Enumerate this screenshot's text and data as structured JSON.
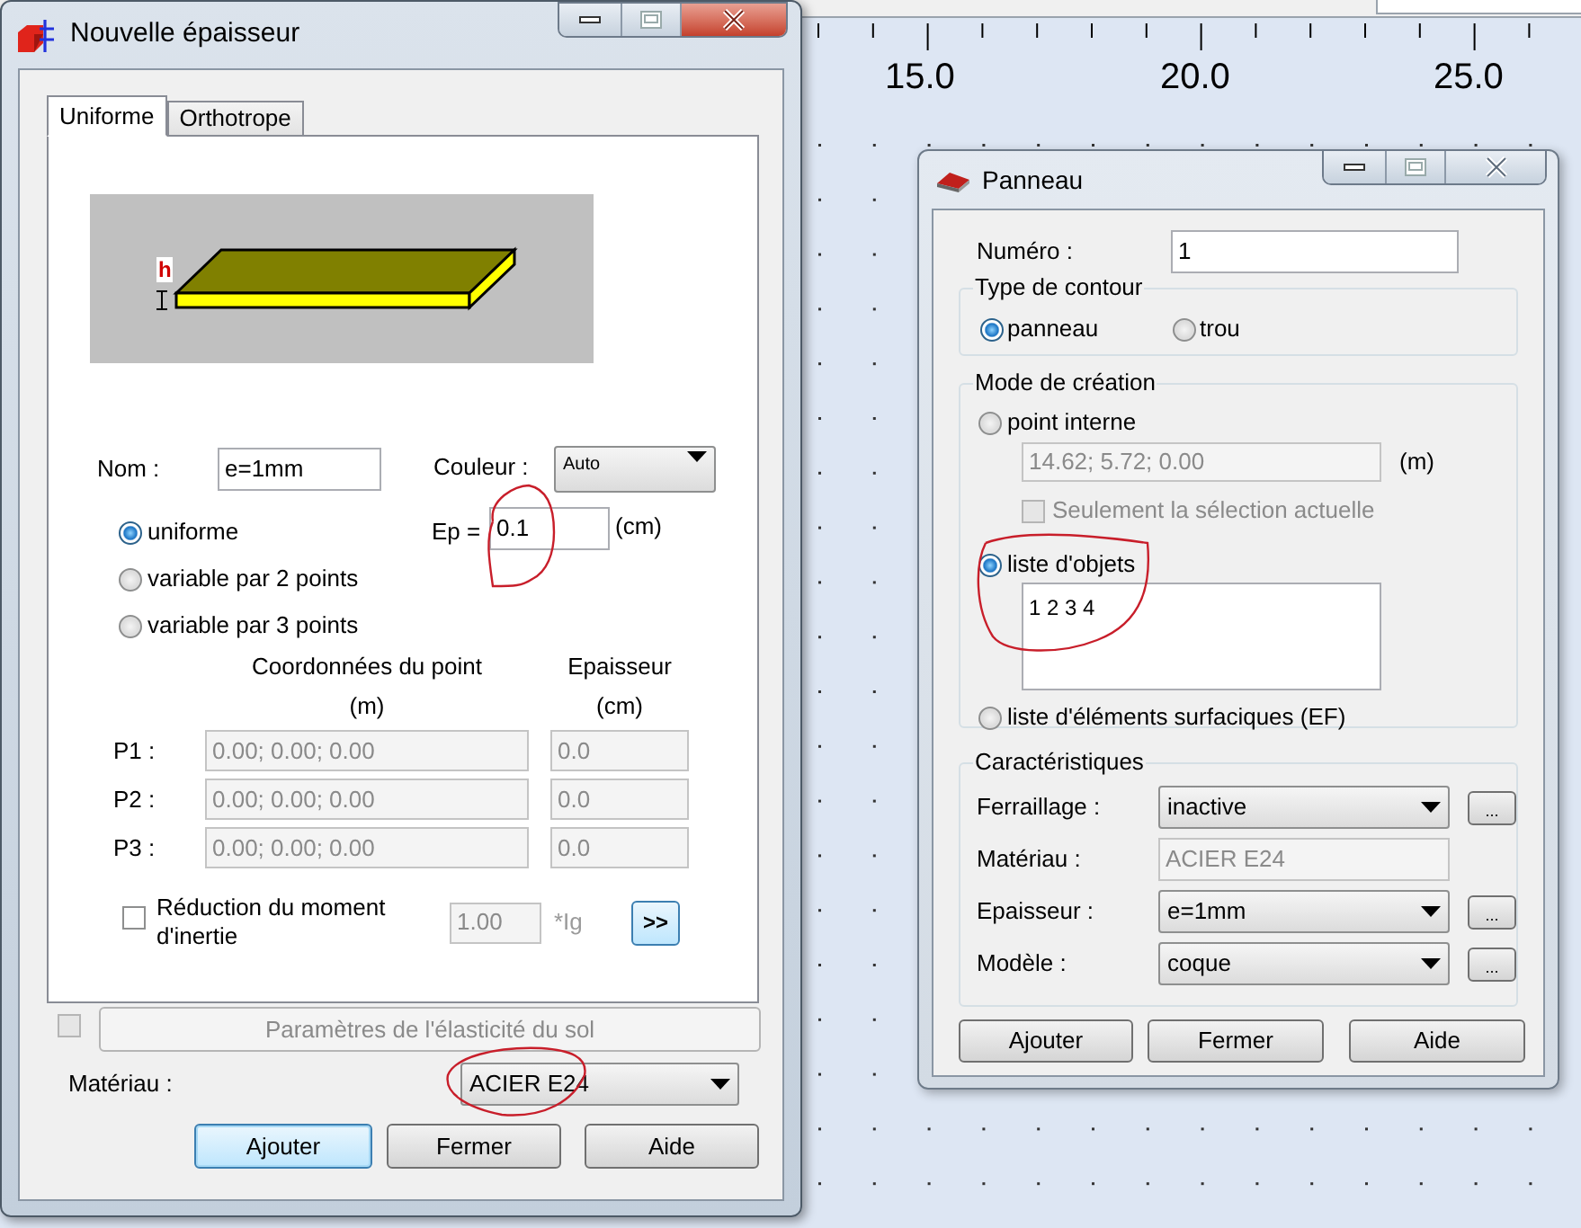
{
  "canvas": {
    "ruler_labels": [
      "15.0",
      "20.0",
      "25.0"
    ]
  },
  "thickness_dialog": {
    "title": "Nouvelle épaisseur",
    "tabs": [
      {
        "label": "Uniforme",
        "selected": true
      },
      {
        "label": "Orthotrope",
        "selected": false
      }
    ],
    "diagram_label": "h",
    "name": {
      "label": "Nom :",
      "value": "e=1mm"
    },
    "color": {
      "label": "Couleur :",
      "value": "Auto"
    },
    "variations": [
      {
        "label": "uniforme",
        "selected": true
      },
      {
        "label": "variable par 2 points",
        "selected": false
      },
      {
        "label": "variable par 3 points",
        "selected": false
      }
    ],
    "ep": {
      "label": "Ep =",
      "value": "0.1",
      "unit": "(cm)"
    },
    "headers": {
      "coordinates": "Coordonnées du point",
      "coordinates_unit": "(m)",
      "thickness": "Epaisseur",
      "thickness_unit": "(cm)"
    },
    "points": [
      {
        "label": "P1 :",
        "coordinates": "0.00; 0.00; 0.00",
        "thickness": "0.0",
        "disabled": true
      },
      {
        "label": "P2 :",
        "coordinates": "0.00; 0.00; 0.00",
        "thickness": "0.0",
        "disabled": true
      },
      {
        "label": "P3 :",
        "coordinates": "0.00; 0.00; 0.00",
        "thickness": "0.0",
        "disabled": true
      }
    ],
    "inertia": {
      "label": "Réduction du moment d'inertie",
      "checked": false,
      "value": "1.00",
      "unit": "*Ig",
      "disabled": true,
      "button": ">>"
    },
    "soil": {
      "checked": false,
      "label": "Paramètres de l'élasticité du sol",
      "disabled": true
    },
    "material": {
      "label": "Matériau :",
      "value": "ACIER E24"
    },
    "buttons": [
      {
        "label": "Ajouter",
        "default": true
      },
      {
        "label": "Fermer",
        "default": false
      },
      {
        "label": "Aide",
        "default": false
      }
    ]
  },
  "panel_dialog": {
    "title": "Panneau",
    "number": {
      "label": "Numéro :",
      "value": "1"
    },
    "contour": {
      "legend": "Type de contour",
      "options": [
        {
          "label": "panneau",
          "selected": true
        },
        {
          "label": "trou",
          "selected": false
        }
      ]
    },
    "creation": {
      "legend": "Mode de création",
      "modes": [
        {
          "kind": "point",
          "label": "point interne",
          "selected": false,
          "value": "14.62; 5.72; 0.00",
          "unit": "(m)",
          "disabled": true,
          "option": {
            "label": "Seulement la sélection actuelle",
            "checked": false,
            "disabled": true
          }
        },
        {
          "kind": "list",
          "label": "liste d'objets",
          "selected": true,
          "value": "1 2 3 4"
        },
        {
          "kind": "plain",
          "label": "liste d'éléments surfaciques (EF)",
          "selected": false
        }
      ]
    },
    "properties": {
      "legend": "Caractéristiques",
      "rows": [
        {
          "kind": "dropdown",
          "label": "Ferraillage :",
          "value": "inactive",
          "more": "..."
        },
        {
          "kind": "field",
          "label": "Matériau :",
          "value": "ACIER E24",
          "disabled": true
        },
        {
          "kind": "dropdown",
          "label": "Epaisseur :",
          "value": "e=1mm",
          "more": "..."
        },
        {
          "kind": "dropdown",
          "label": "Modèle :",
          "value": "coque",
          "more": "..."
        }
      ]
    },
    "buttons": [
      {
        "label": "Ajouter",
        "default": false
      },
      {
        "label": "Fermer",
        "default": false
      },
      {
        "label": "Aide",
        "default": false
      }
    ]
  }
}
